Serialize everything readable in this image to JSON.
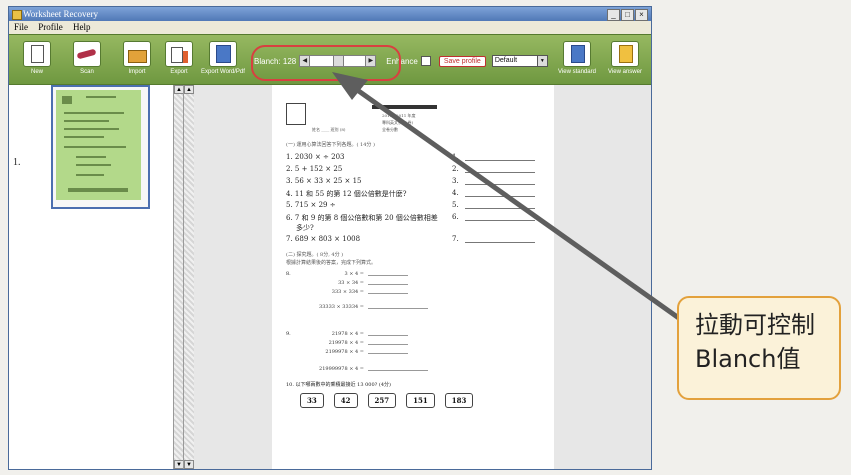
{
  "window": {
    "title": "Worksheet Recovery",
    "controls": [
      "_",
      "□",
      "×"
    ]
  },
  "menu": [
    "File",
    "Profile",
    "Help"
  ],
  "toolbar": {
    "buttons": {
      "new": "New",
      "scan": "Scan",
      "import": "Import",
      "export": "Export",
      "export_doc": "Export Word/Pdf",
      "view_standard": "View standard",
      "view_answer": "View answer"
    },
    "blanch_label": "Blanch: 128",
    "blanch_value": 128,
    "blanch_max": 255,
    "enhance_label": "Enhance",
    "enhance_checked": false,
    "save_profile_label": "Save profile",
    "profile_select": "Default"
  },
  "thumbnails": {
    "index_label": "1."
  },
  "document": {
    "header_right": [
      "2010 - 2011 年度",
      "專科英文系(八卷)",
      "全卷分數"
    ],
    "header_left": "姓名 ____    班別 (8)",
    "section1": "(一) 運用心算法回答下列各題。( 14分 )",
    "questions": [
      {
        "num": "1.",
        "text": "2030  ×  ÷ 203"
      },
      {
        "num": "2.",
        "text": "5 + 152  × 25"
      },
      {
        "num": "3.",
        "text": "56 × 33 × 25 × 15"
      },
      {
        "num": "4.",
        "text": "11 和 55 的第 12 個公倍數是什麼?"
      },
      {
        "num": "5.",
        "text": "715 × 29  ÷"
      },
      {
        "num": "6.",
        "text": "7 和 9 的第 8 個公倍數和第 20 個公倍數相差"
      },
      {
        "num": "",
        "text": "多少?"
      },
      {
        "num": "7.",
        "text": "689 × 803 × 1008"
      }
    ],
    "answer_nums": [
      "1.",
      "2.",
      "3.",
      "4.",
      "5.",
      "6.",
      "7."
    ],
    "section2": "(二) 探究題。( 8分, 4分 )",
    "section2_sub": "根據計算結果後的答案，完成下列算式。",
    "q8_num": "8.",
    "q8_lines": [
      "3 × 4  =",
      "33 × 34  =",
      "333 × 334  =",
      "33333 × 33334  ="
    ],
    "q9_num": "9.",
    "q9_lines": [
      "21978 × 4  =",
      "219978 × 4  =",
      "2199978 × 4  =",
      "219999978 × 4  ="
    ],
    "q10": "10.  以下哪兩數中的乘積最接近 13 000?   (4分)",
    "answer_boxes": [
      "33",
      "42",
      "257",
      "151",
      "183"
    ]
  },
  "callout": {
    "line1": "拉動可控制",
    "line2": "Blanch值"
  },
  "colors": {
    "toolbar_green": "#7fa64c",
    "highlight_red": "#d84040",
    "arrow": "#5e5e5e",
    "callout_border": "#e3a13c",
    "callout_bg": "#fbf2d9",
    "thumb_green": "#b3d98a"
  }
}
